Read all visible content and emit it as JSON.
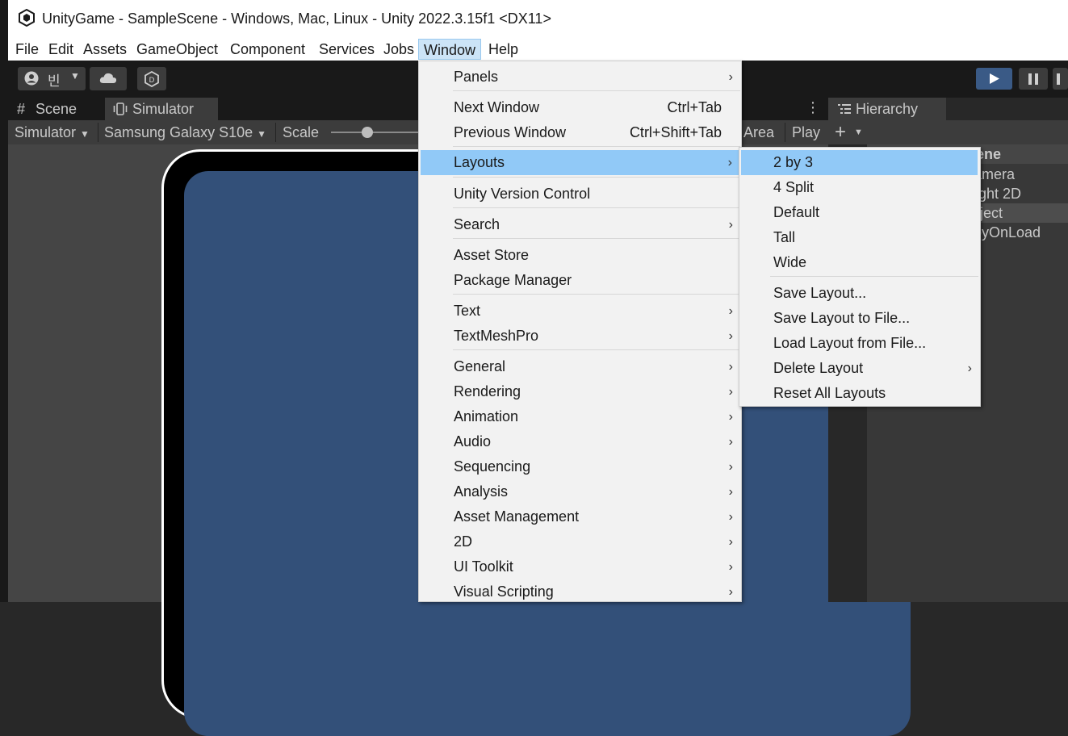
{
  "window_title": "UnityGame - SampleScene - Windows, Mac, Linux - Unity 2022.3.15f1 <DX11>",
  "menubar": [
    "File",
    "Edit",
    "Assets",
    "GameObject",
    "Component",
    "Services",
    "Jobs",
    "Window",
    "Help"
  ],
  "account_label": "빈",
  "tabs": {
    "scene": "Scene",
    "simulator": "Simulator",
    "hierarchy": "Hierarchy"
  },
  "simbar": {
    "mode": "Simulator",
    "device": "Samsung Galaxy S10e",
    "scale": "Scale",
    "area": "Area",
    "play": "Play"
  },
  "hierarchy_rows": [
    "ene",
    "amera",
    "ight 2D",
    "oject",
    "oyOnLoad"
  ],
  "window_menu": [
    {
      "label": "Panels",
      "submenu": true
    },
    {
      "label": "Next Window",
      "shortcut": "Ctrl+Tab"
    },
    {
      "label": "Previous Window",
      "shortcut": "Ctrl+Shift+Tab"
    },
    {
      "label": "Layouts",
      "submenu": true,
      "highlighted": true
    },
    {
      "label": "Unity Version Control"
    },
    {
      "label": "Search",
      "submenu": true
    },
    {
      "label": "Asset Store"
    },
    {
      "label": "Package Manager"
    },
    {
      "label": "Text",
      "submenu": true
    },
    {
      "label": "TextMeshPro",
      "submenu": true
    },
    {
      "label": "General",
      "submenu": true
    },
    {
      "label": "Rendering",
      "submenu": true
    },
    {
      "label": "Animation",
      "submenu": true
    },
    {
      "label": "Audio",
      "submenu": true
    },
    {
      "label": "Sequencing",
      "submenu": true
    },
    {
      "label": "Analysis",
      "submenu": true
    },
    {
      "label": "Asset Management",
      "submenu": true
    },
    {
      "label": "2D",
      "submenu": true
    },
    {
      "label": "UI Toolkit",
      "submenu": true
    },
    {
      "label": "Visual Scripting",
      "submenu": true
    }
  ],
  "layouts_menu": [
    {
      "label": "2 by 3",
      "highlighted": true
    },
    {
      "label": "4 Split"
    },
    {
      "label": "Default"
    },
    {
      "label": "Tall"
    },
    {
      "label": "Wide"
    },
    {
      "label": "Save Layout..."
    },
    {
      "label": "Save Layout to File..."
    },
    {
      "label": "Load Layout from File..."
    },
    {
      "label": "Delete Layout",
      "submenu": true
    },
    {
      "label": "Reset All Layouts"
    }
  ],
  "colors": {
    "menu_highlight": "#91c9f7",
    "device_screen": "#335079",
    "play_button": "#3a5a86"
  }
}
